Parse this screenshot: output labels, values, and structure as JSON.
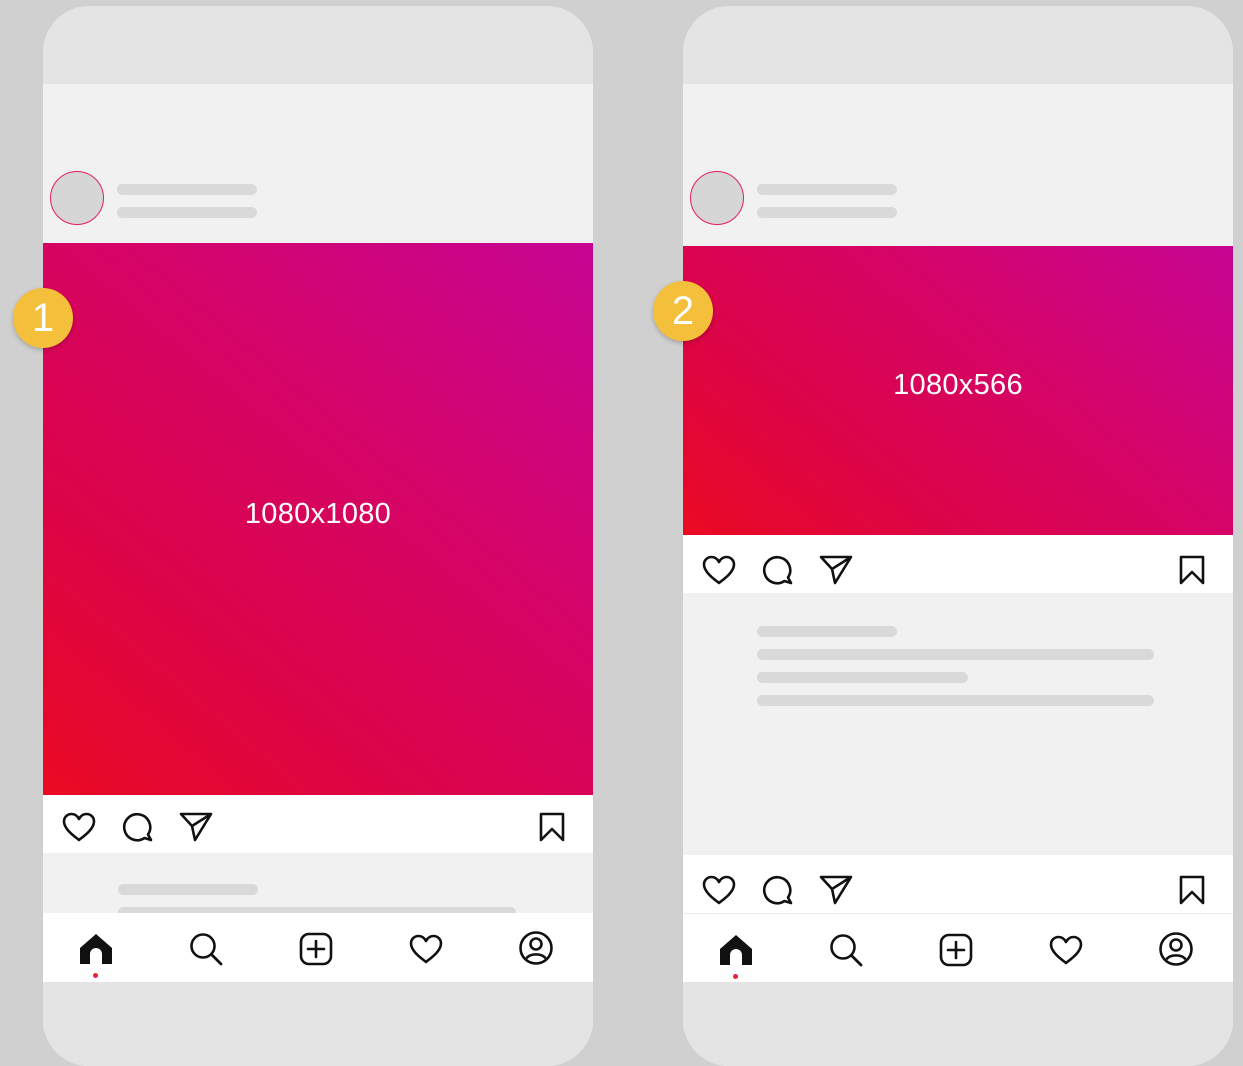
{
  "phones": [
    {
      "badge": "1",
      "image_label": "1080x1080",
      "nav": {
        "active": "home"
      }
    },
    {
      "badge": "2",
      "image_label": "1080x566",
      "nav": {
        "active": "home"
      }
    }
  ],
  "icons": {
    "actions": [
      "heart-icon",
      "comment-icon",
      "send-icon",
      "bookmark-icon"
    ],
    "nav": [
      "home-icon",
      "search-icon",
      "add-post-icon",
      "activity-heart-icon",
      "profile-icon"
    ]
  },
  "colors": {
    "background": "#d0d0d0",
    "phone_frame": "#e4e4e4",
    "feed": "#f1f1f1",
    "skeleton": "#d9d9d9",
    "gradient_start": "#ea0a22",
    "gradient_end": "#c50492",
    "badge": "#f4bf3a",
    "active_dot": "#e5223f"
  }
}
